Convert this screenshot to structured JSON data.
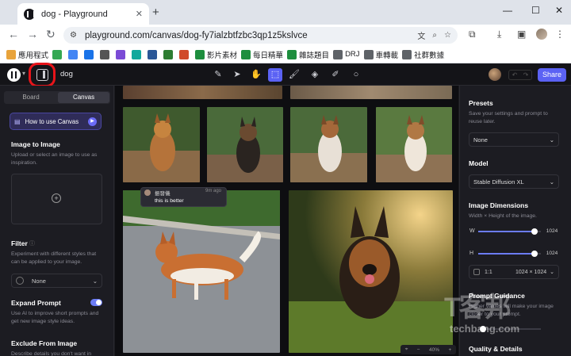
{
  "browser": {
    "tab_title": "dog - Playground",
    "new_tab": "+",
    "url": "playground.com/canvas/dog-fy7ialzbtfzbc3qp1z5kslvce",
    "bookmarks": [
      {
        "label": "應用程式",
        "color": "#e8a33b"
      },
      {
        "label": "",
        "color": "#34a853"
      },
      {
        "label": "",
        "color": "#4285f4"
      },
      {
        "label": "",
        "color": "#1a73e8"
      },
      {
        "label": "",
        "color": "#555555"
      },
      {
        "label": "",
        "color": "#7b4bd6"
      },
      {
        "label": "",
        "color": "#12a89d"
      },
      {
        "label": "",
        "color": "#2b5797"
      },
      {
        "label": "",
        "color": "#2e7d32"
      },
      {
        "label": "",
        "color": "#d04a2a"
      },
      {
        "label": "影片素材",
        "color": "#1e8e3e"
      },
      {
        "label": "每日精華",
        "color": "#1e8e3e"
      },
      {
        "label": "雜誌題目",
        "color": "#1e8e3e"
      },
      {
        "label": "DRJ",
        "color": "#5f6368"
      },
      {
        "label": "車轉載",
        "color": "#5f6368"
      },
      {
        "label": "社群數據",
        "color": "#5f6368"
      }
    ]
  },
  "app": {
    "project_name": "dog",
    "share_label": "Share",
    "accent": "#5b62f4",
    "highlight": "#e8141a"
  },
  "left_panel": {
    "tabs": [
      "Board",
      "Canvas"
    ],
    "active_tab": "Canvas",
    "how_to": "How to use Canvas",
    "image_to_image": {
      "title": "Image to Image",
      "desc": "Upload or select an image to use as inspiration."
    },
    "filter": {
      "title": "Filter",
      "desc": "Experiment with different styles that can be applied to your image.",
      "value": "None"
    },
    "expand_prompt": {
      "title": "Expand Prompt",
      "desc": "Use AI to improve short prompts and get new image style ideas.",
      "enabled": true
    },
    "exclude": {
      "title": "Exclude From Image",
      "desc": "Describe details you don't want in"
    }
  },
  "canvas": {
    "comment": {
      "author": "振發儀",
      "time": "9m ago",
      "message": "this is better"
    },
    "zoom": "40%"
  },
  "right_panel": {
    "presets": {
      "title": "Presets",
      "desc": "Save your settings and prompt to reuse later.",
      "value": "None"
    },
    "model": {
      "title": "Model",
      "value": "Stable Diffusion XL"
    },
    "dimensions": {
      "title": "Image Dimensions",
      "desc": "Width × Height of the image.",
      "w_label": "W",
      "w_value": "1024",
      "w_fraction": 0.9,
      "h_label": "H",
      "h_value": "1024",
      "h_fraction": 0.9,
      "ratio": "1:1",
      "ratio_value": "1024 × 1024"
    },
    "prompt_guidance": {
      "title": "Prompt Guidance",
      "desc": "Higher values will make your image closer to your prompt."
    },
    "quality": {
      "title": "Quality & Details"
    }
  },
  "watermark": {
    "main": "T客邦",
    "sub": "techbang.com"
  }
}
